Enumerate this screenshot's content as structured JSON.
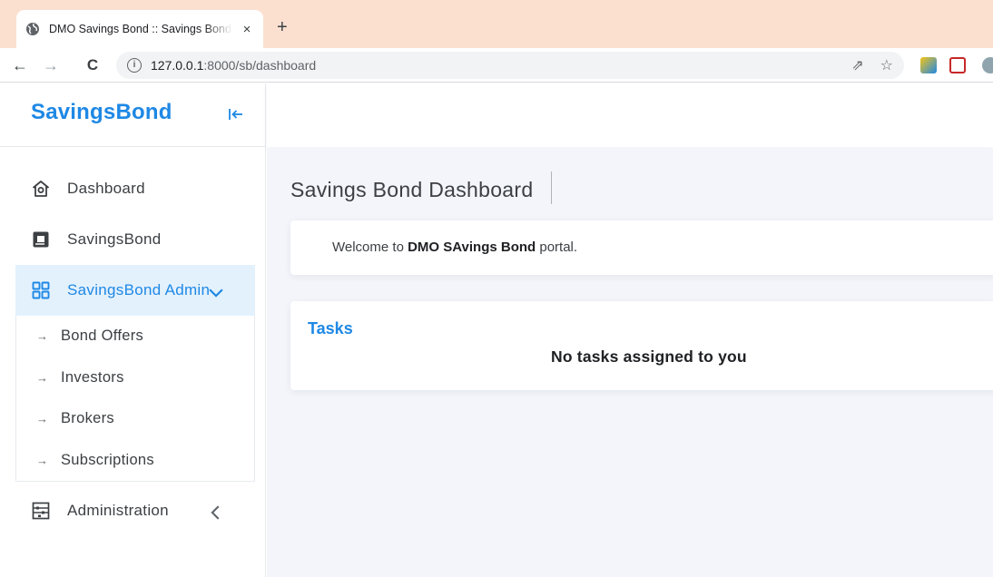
{
  "browser": {
    "tab_title": "DMO Savings Bond :: Savings Bond",
    "tab_close": "×",
    "new_tab": "+",
    "back": "←",
    "forward": "→",
    "reload": "C",
    "url_host": "127.0.0.1",
    "url_path": ":8000/sb/dashboard",
    "share_icon": "⇗",
    "star_icon": "☆"
  },
  "sidebar": {
    "brand": "SavingsBond",
    "items": [
      {
        "label": "Dashboard",
        "icon": "home-icon"
      },
      {
        "label": "SavingsBond",
        "icon": "gallery-icon"
      },
      {
        "label": "SavingsBond Admin",
        "icon": "grid-icon",
        "active": true
      },
      {
        "label": "Administration",
        "icon": "abacus-icon"
      }
    ],
    "subitems": [
      {
        "label": "Bond Offers"
      },
      {
        "label": "Investors"
      },
      {
        "label": "Brokers"
      },
      {
        "label": "Subscriptions"
      }
    ],
    "arrow": "→"
  },
  "main": {
    "page_title": "Savings Bond Dashboard",
    "welcome_prefix": "Welcome to ",
    "welcome_bold": "DMO SAvings Bond",
    "welcome_suffix": " portal.",
    "tasks_title": "Tasks",
    "tasks_empty": "No tasks assigned to you"
  },
  "colors": {
    "accent": "#1e88e5",
    "active_bg": "#e3f1fd",
    "content_bg": "#f3f5fa",
    "tabstrip_bg": "#fbe0d0"
  }
}
